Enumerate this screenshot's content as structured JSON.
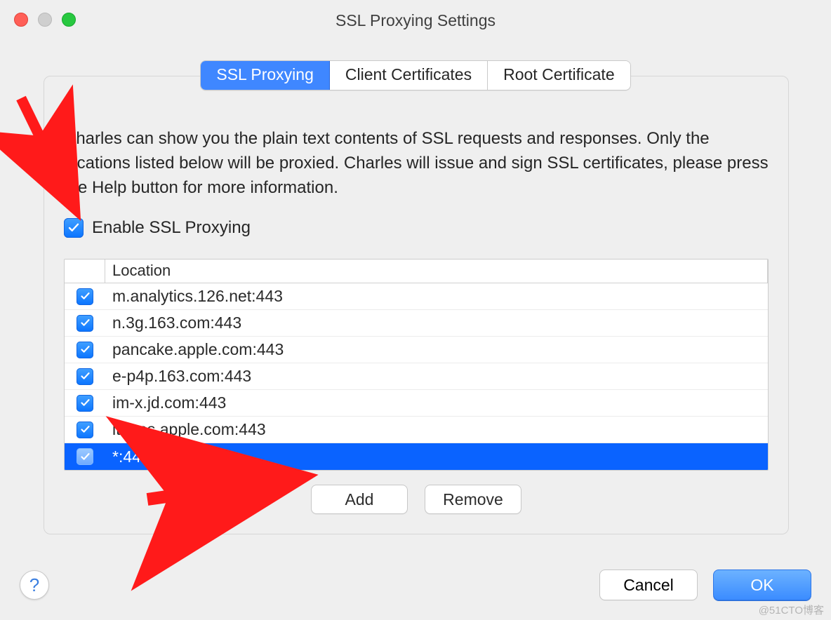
{
  "window": {
    "title": "SSL Proxying Settings"
  },
  "tabs": [
    {
      "label": "SSL Proxying",
      "active": true
    },
    {
      "label": "Client Certificates",
      "active": false
    },
    {
      "label": "Root Certificate",
      "active": false
    }
  ],
  "description": "Charles can show you the plain text contents of SSL requests and responses. Only the locations listed below will be proxied. Charles will issue and sign SSL certificates, please press the Help button for more information.",
  "enable_checkbox": {
    "checked": true,
    "label": "Enable SSL Proxying"
  },
  "table": {
    "header": "Location",
    "rows": [
      {
        "checked": true,
        "location": "m.analytics.126.net:443",
        "selected": false
      },
      {
        "checked": true,
        "location": "n.3g.163.com:443",
        "selected": false
      },
      {
        "checked": true,
        "location": "pancake.apple.com:443",
        "selected": false
      },
      {
        "checked": true,
        "location": "e-p4p.163.com:443",
        "selected": false
      },
      {
        "checked": true,
        "location": "im-x.jd.com:443",
        "selected": false
      },
      {
        "checked": true,
        "location": "itunes.apple.com:443",
        "selected": false
      },
      {
        "checked": true,
        "location": "*:443",
        "selected": true
      }
    ]
  },
  "buttons": {
    "add": "Add",
    "remove": "Remove",
    "help": "?",
    "cancel": "Cancel",
    "ok": "OK"
  },
  "watermark": "@51CTO博客"
}
